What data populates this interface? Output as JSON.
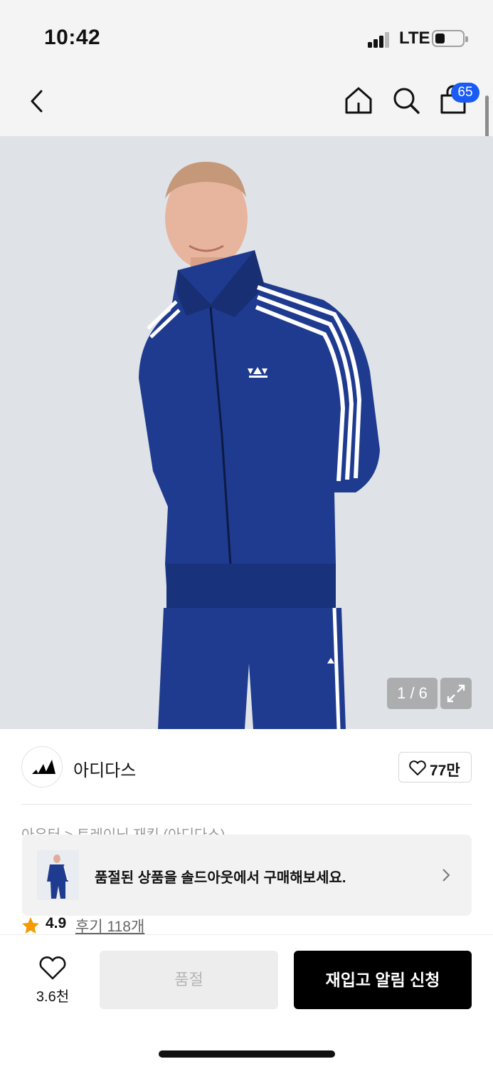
{
  "status_bar": {
    "time": "10:42",
    "network": "LTE"
  },
  "nav": {
    "cart_count": "65",
    "icons": [
      "chevron-left-icon",
      "home-icon",
      "search-icon",
      "shopping-bag-icon"
    ]
  },
  "gallery": {
    "counter": "1 / 6",
    "current_index": 1,
    "total": 6
  },
  "brand": {
    "name": "아디다스",
    "likes": "77만"
  },
  "product": {
    "category_partial": "아우터 > 트레이닝 재킷 (아디다스)",
    "rating": "4.9",
    "reviews_label": "후기 118개"
  },
  "soldout_banner": {
    "text": "품절된 상품을 솔드아웃에서 구매해보세요."
  },
  "bottom": {
    "wishlist_count": "3.6천",
    "soldout_label": "품절",
    "restock_label": "재입고 알림 신청"
  },
  "colors": {
    "badge": "#1b5bf5",
    "star": "#f59a00",
    "jacket": "#1f3b8f",
    "primary_button": "#000000",
    "disabled_button": "#ededed"
  }
}
